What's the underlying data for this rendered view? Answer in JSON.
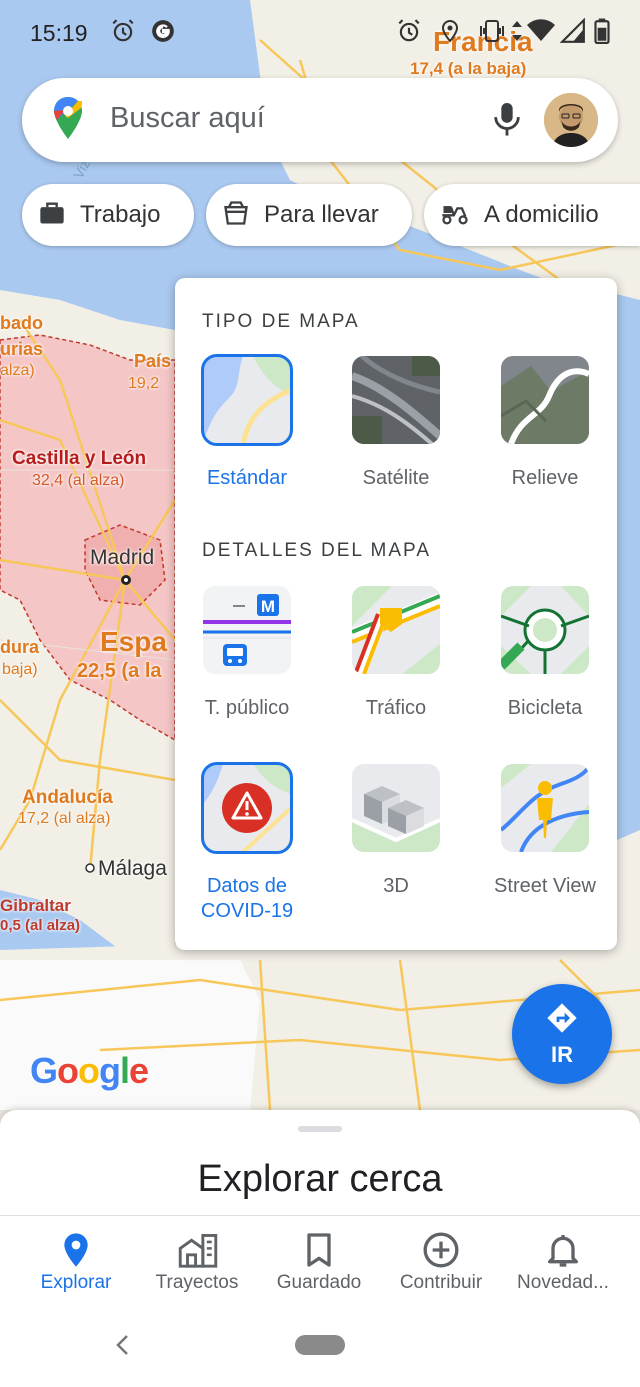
{
  "status_bar": {
    "time": "15:19",
    "icons": [
      "alarm-icon",
      "google-g-icon",
      "alarm-icon",
      "location-icon",
      "vibrate-icon",
      "data-arrows-icon",
      "wifi-icon",
      "signal-icon",
      "battery-icon"
    ]
  },
  "map": {
    "labels": {
      "francia": "Francia",
      "francia_sub": "17,4 (a la baja)",
      "cantabria_partial": "bado",
      "asturias_partial": "urias",
      "asturias_sub_partial": "alza)",
      "pais_partial": "País",
      "pais_sub_partial": "19,2",
      "castilla": "Castilla y León",
      "castilla_sub": "32,4 (al alza)",
      "madrid": "Madrid",
      "espana_partial": "Espa",
      "espana_sub_partial": "22,5 (a la",
      "extremadura_partial": "dura",
      "extremadura_sub_partial": "baja)",
      "andalucia": "Andalucía",
      "andalucia_sub": "17,2 (al alza)",
      "malaga": "Málaga",
      "gibraltar": "Gibraltar",
      "gibraltar_sub": "0,5 (al alza)",
      "water_partial": "Viz"
    },
    "google_logo": "Google",
    "colors": {
      "land": "#f2efe6",
      "water": "#aac9f0",
      "covid_region": "#f5c6c6",
      "roads": "#f7c75a",
      "border": "#c0392b"
    }
  },
  "search": {
    "placeholder": "Buscar aquí",
    "mic_icon": "mic-icon",
    "avatar_icon": "user-avatar"
  },
  "chips": [
    {
      "label": "Trabajo",
      "icon": "briefcase-icon"
    },
    {
      "label": "Para llevar",
      "icon": "takeout-icon"
    },
    {
      "label": "A domicilio",
      "icon": "delivery-icon"
    }
  ],
  "layers_panel": {
    "map_type_title": "TIPO DE MAPA",
    "map_types": [
      {
        "label": "Estándar",
        "selected": true
      },
      {
        "label": "Satélite",
        "selected": false
      },
      {
        "label": "Relieve",
        "selected": false
      }
    ],
    "details_title": "DETALLES DEL MAPA",
    "details": [
      {
        "label": "T. público",
        "selected": false
      },
      {
        "label": "Tráfico",
        "selected": false
      },
      {
        "label": "Bicicleta",
        "selected": false
      },
      {
        "label": "Datos de COVID-19",
        "selected": true
      },
      {
        "label": "3D",
        "selected": false
      },
      {
        "label": "Street View",
        "selected": false
      }
    ]
  },
  "ir_button": {
    "label": "IR",
    "icon": "directions-icon"
  },
  "bottom_sheet": {
    "title": "Explorar cerca"
  },
  "bottom_nav": [
    {
      "label": "Explorar",
      "icon": "location-pin-icon",
      "active": true
    },
    {
      "label": "Trayectos",
      "icon": "commute-icon",
      "active": false
    },
    {
      "label": "Guardado",
      "icon": "bookmark-icon",
      "active": false
    },
    {
      "label": "Contribuir",
      "icon": "add-circle-icon",
      "active": false
    },
    {
      "label": "Novedad...",
      "icon": "bell-icon",
      "active": false
    }
  ]
}
